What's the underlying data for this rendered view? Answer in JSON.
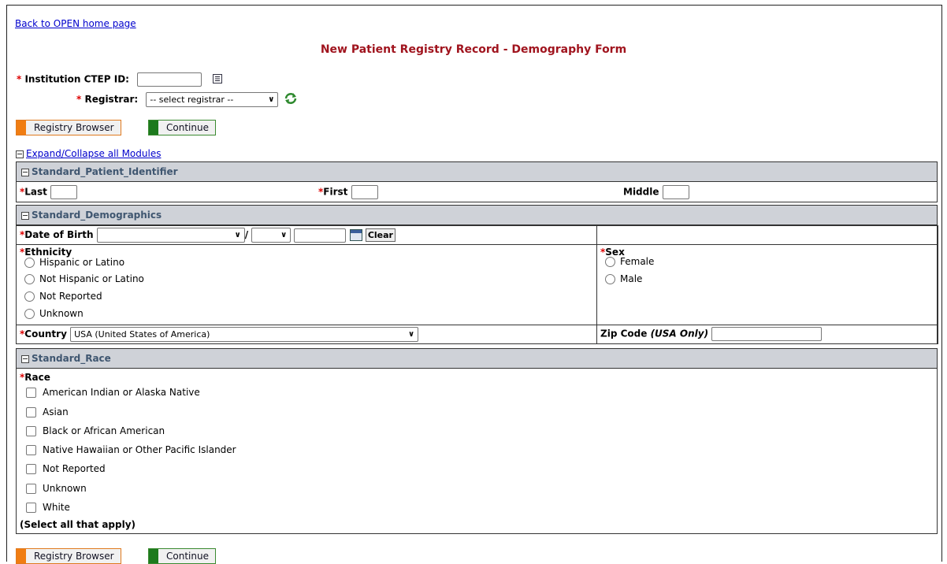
{
  "nav": {
    "back_link": "Back to OPEN home page"
  },
  "page_title": "New Patient Registry Record - Demography Form",
  "header_form": {
    "required_marker": "*",
    "institution_label": "Institution CTEP ID:",
    "institution_value": "",
    "registrar_label": "Registrar:",
    "registrar_selected": "-- select registrar --"
  },
  "buttons": {
    "registry_browser": "Registry Browser",
    "continue": "Continue"
  },
  "expand_collapse": "Expand/Collapse all Modules",
  "modules": {
    "patient_identifier": {
      "title": "Standard_Patient_Identifier",
      "last_label": "Last",
      "first_label": "First",
      "middle_label": "Middle"
    },
    "demographics": {
      "title": "Standard_Demographics",
      "dob_label": "Date of Birth",
      "dob_separator": "/",
      "clear_button": "Clear",
      "ethnicity_label": "Ethnicity",
      "ethnicity_options": [
        "Hispanic or Latino",
        "Not Hispanic or Latino",
        "Not Reported",
        "Unknown"
      ],
      "sex_label": "Sex",
      "sex_options": [
        "Female",
        "Male"
      ],
      "country_label": "Country",
      "country_selected": "USA (United States of America)",
      "zip_label": "Zip Code",
      "zip_note": "(USA Only)"
    },
    "race": {
      "title": "Standard_Race",
      "race_label": "Race",
      "race_options": [
        "American Indian or Alaska Native",
        "Asian",
        "Black or African American",
        "Native Hawaiian or Other Pacific Islander",
        "Not Reported",
        "Unknown",
        "White"
      ],
      "note": "(Select all that apply)"
    }
  },
  "colors": {
    "title": "#a0141e",
    "module_header_bg": "#cfd2d8",
    "module_header_text": "#3f5670",
    "required": "#dd0000",
    "link": "#0000cc",
    "orange_accent": "#f07d12",
    "green_accent": "#1d7a1d"
  },
  "icons": [
    "list-icon",
    "refresh-icon",
    "calendar-icon",
    "collapse-icon",
    "chevron-down-icon",
    "radio-icon",
    "checkbox-icon"
  ]
}
